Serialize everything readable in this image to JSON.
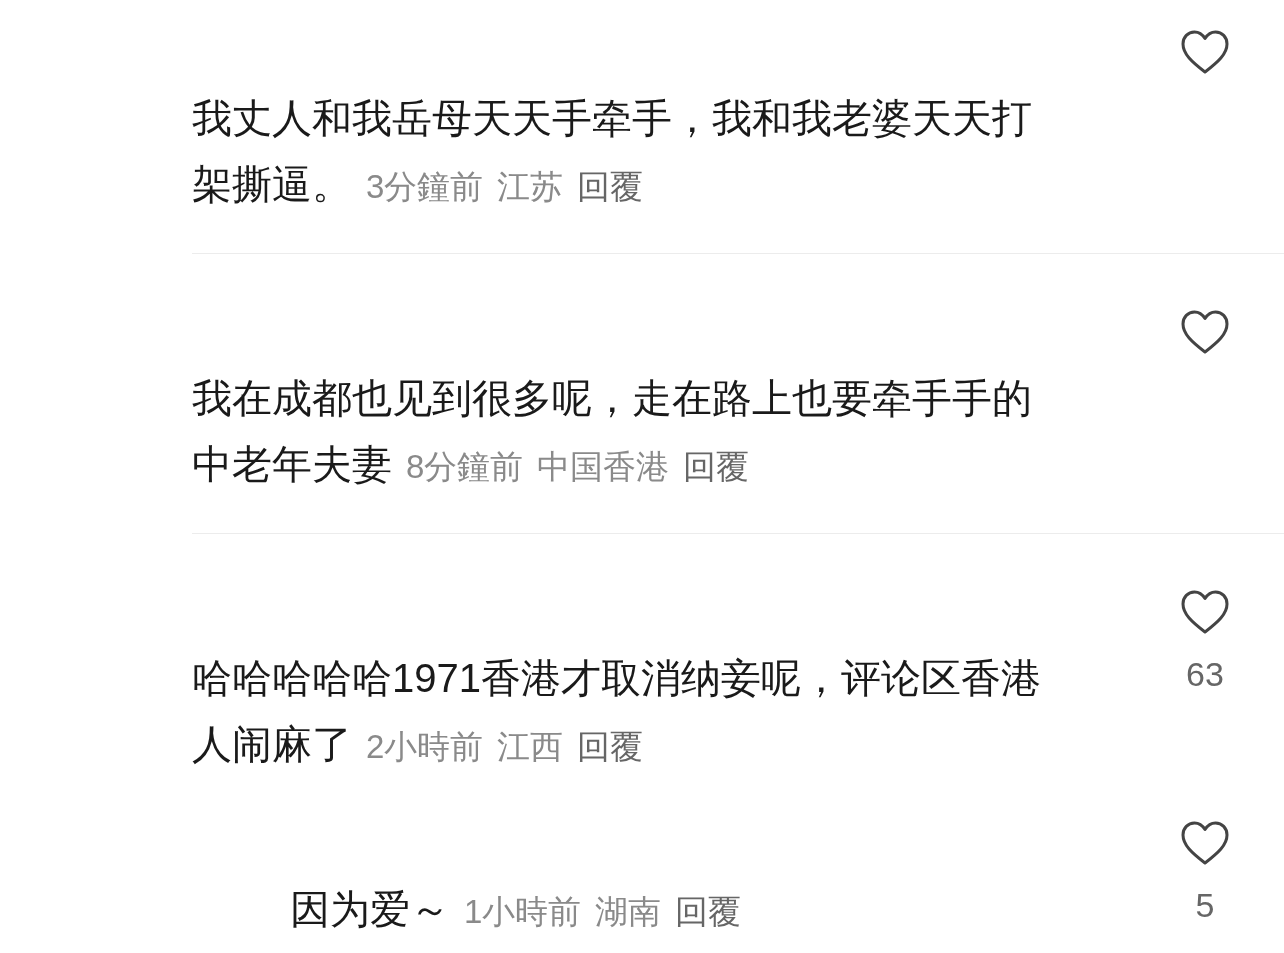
{
  "comments": [
    {
      "kind": "comment",
      "lines": [
        "我丈人和我岳母天天手牵手，我和我老婆天天打",
        "架撕逼。"
      ],
      "time": "3分鐘前",
      "location": "江苏",
      "reply": "回覆"
    },
    {
      "kind": "comment",
      "lines": [
        "我在成都也见到很多呢，走在路上也要牵手手的",
        "中老年夫妻"
      ],
      "time": "8分鐘前",
      "location": "中国香港",
      "reply": "回覆"
    },
    {
      "kind": "comment",
      "lines": [
        "哈哈哈哈哈1971香港才取消纳妾呢，评论区香港",
        "人闹麻了"
      ],
      "time": "2小時前",
      "location": "江西",
      "reply": "回覆",
      "likes": "63"
    },
    {
      "kind": "reply",
      "lines": [
        "因为爱～"
      ],
      "time": "1小時前",
      "location": "湖南",
      "reply": "回覆",
      "likes": "5"
    }
  ]
}
